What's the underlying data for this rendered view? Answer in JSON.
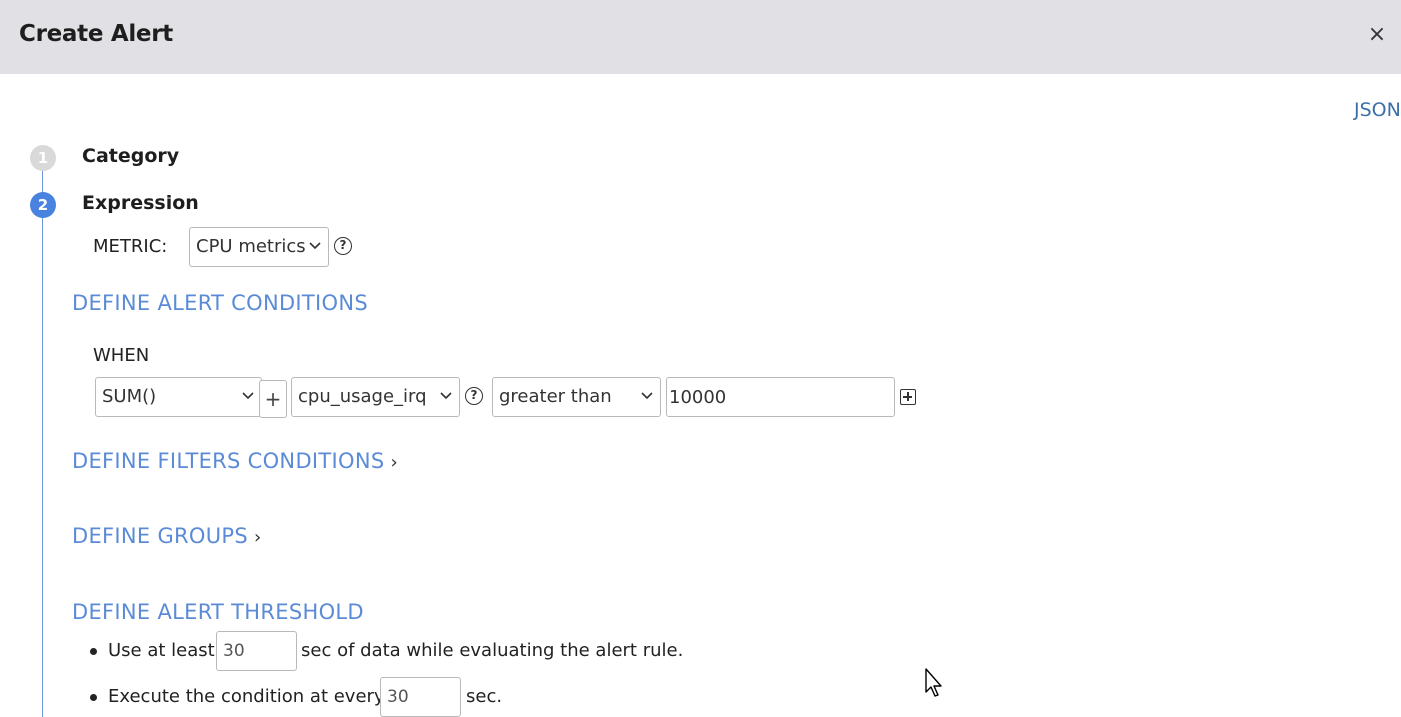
{
  "header": {
    "title": "Create Alert",
    "close_icon": "close-icon"
  },
  "json_link": "JSON",
  "steps": [
    {
      "number": "1",
      "label": "Category",
      "state": "inactive"
    },
    {
      "number": "2",
      "label": "Expression",
      "state": "active"
    }
  ],
  "metric": {
    "label": "METRIC:",
    "selected": "CPU metrics"
  },
  "alert_conditions": {
    "title": "DEFINE ALERT CONDITIONS",
    "when_label": "WHEN",
    "aggregation": "SUM()",
    "plus_label": "+",
    "field": "cpu_usage_irq",
    "operator": "greater than",
    "value": "10000"
  },
  "filters": {
    "title": "DEFINE FILTERS CONDITIONS"
  },
  "groups": {
    "title": "DEFINE GROUPS"
  },
  "threshold": {
    "title": "DEFINE ALERT THRESHOLD",
    "line1_before": "Use at least",
    "line1_value": "30",
    "line1_after": "sec of data while evaluating the alert rule.",
    "line2_before": "Execute the condition at every",
    "line2_value": "30",
    "line2_after": "sec."
  },
  "colors": {
    "accent": "#5b8bd6",
    "step_active": "#4a82e0",
    "header_bg": "#e1e1e5"
  }
}
